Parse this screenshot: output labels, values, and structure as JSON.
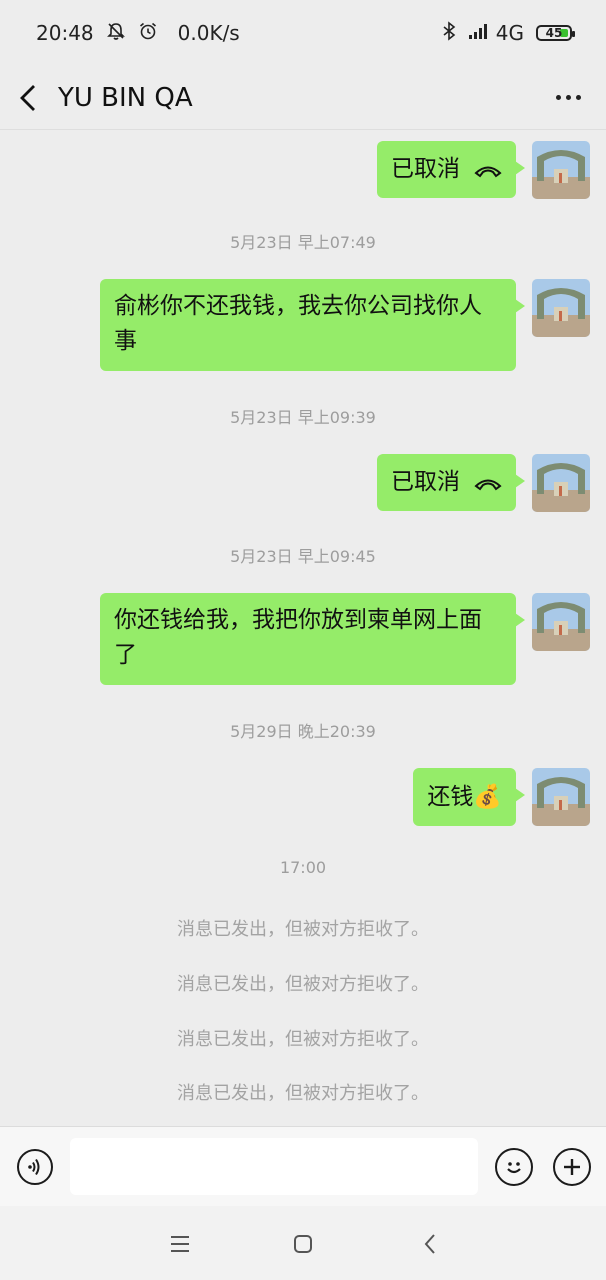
{
  "status_bar": {
    "time": "20:48",
    "speed": "0.0K/s",
    "network": "4G",
    "battery": "45",
    "icons": [
      "mute-bell-icon",
      "alarm-icon",
      "bluetooth-icon",
      "signal-icon"
    ]
  },
  "header": {
    "title": "YU BIN QA",
    "icons": [
      "back-icon",
      "more-icon"
    ]
  },
  "messages": [
    {
      "type": "call",
      "text": "已取消",
      "icon": "phone-hangup-icon"
    },
    {
      "type": "time",
      "text": "5月23日 早上07:49"
    },
    {
      "type": "text",
      "text": "俞彬你不还我钱，我去你公司找你人事"
    },
    {
      "type": "time",
      "text": "5月23日 早上09:39"
    },
    {
      "type": "call",
      "text": "已取消",
      "icon": "phone-hangup-icon"
    },
    {
      "type": "time",
      "text": "5月23日 早上09:45"
    },
    {
      "type": "text",
      "text": "你还钱给我，我把你放到柬单网上面了"
    },
    {
      "type": "time",
      "text": "5月29日 晚上20:39"
    },
    {
      "type": "text",
      "text": "还钱💰"
    },
    {
      "type": "time",
      "text": "17:00"
    },
    {
      "type": "system",
      "text": "消息已发出，但被对方拒收了。"
    },
    {
      "type": "system",
      "text": "消息已发出，但被对方拒收了。"
    },
    {
      "type": "system",
      "text": "消息已发出，但被对方拒收了。"
    },
    {
      "type": "system",
      "text": "消息已发出，但被对方拒收了。"
    }
  ],
  "input_bar": {
    "value": "",
    "icons": [
      "voice-icon",
      "emoji-icon",
      "plus-icon"
    ]
  },
  "nav_bar": {
    "icons": [
      "menu-icon",
      "home-icon",
      "back-nav-icon"
    ]
  },
  "colors": {
    "bubble": "#95ec69",
    "background": "#ededed",
    "timestamp": "#9d9d9d"
  }
}
